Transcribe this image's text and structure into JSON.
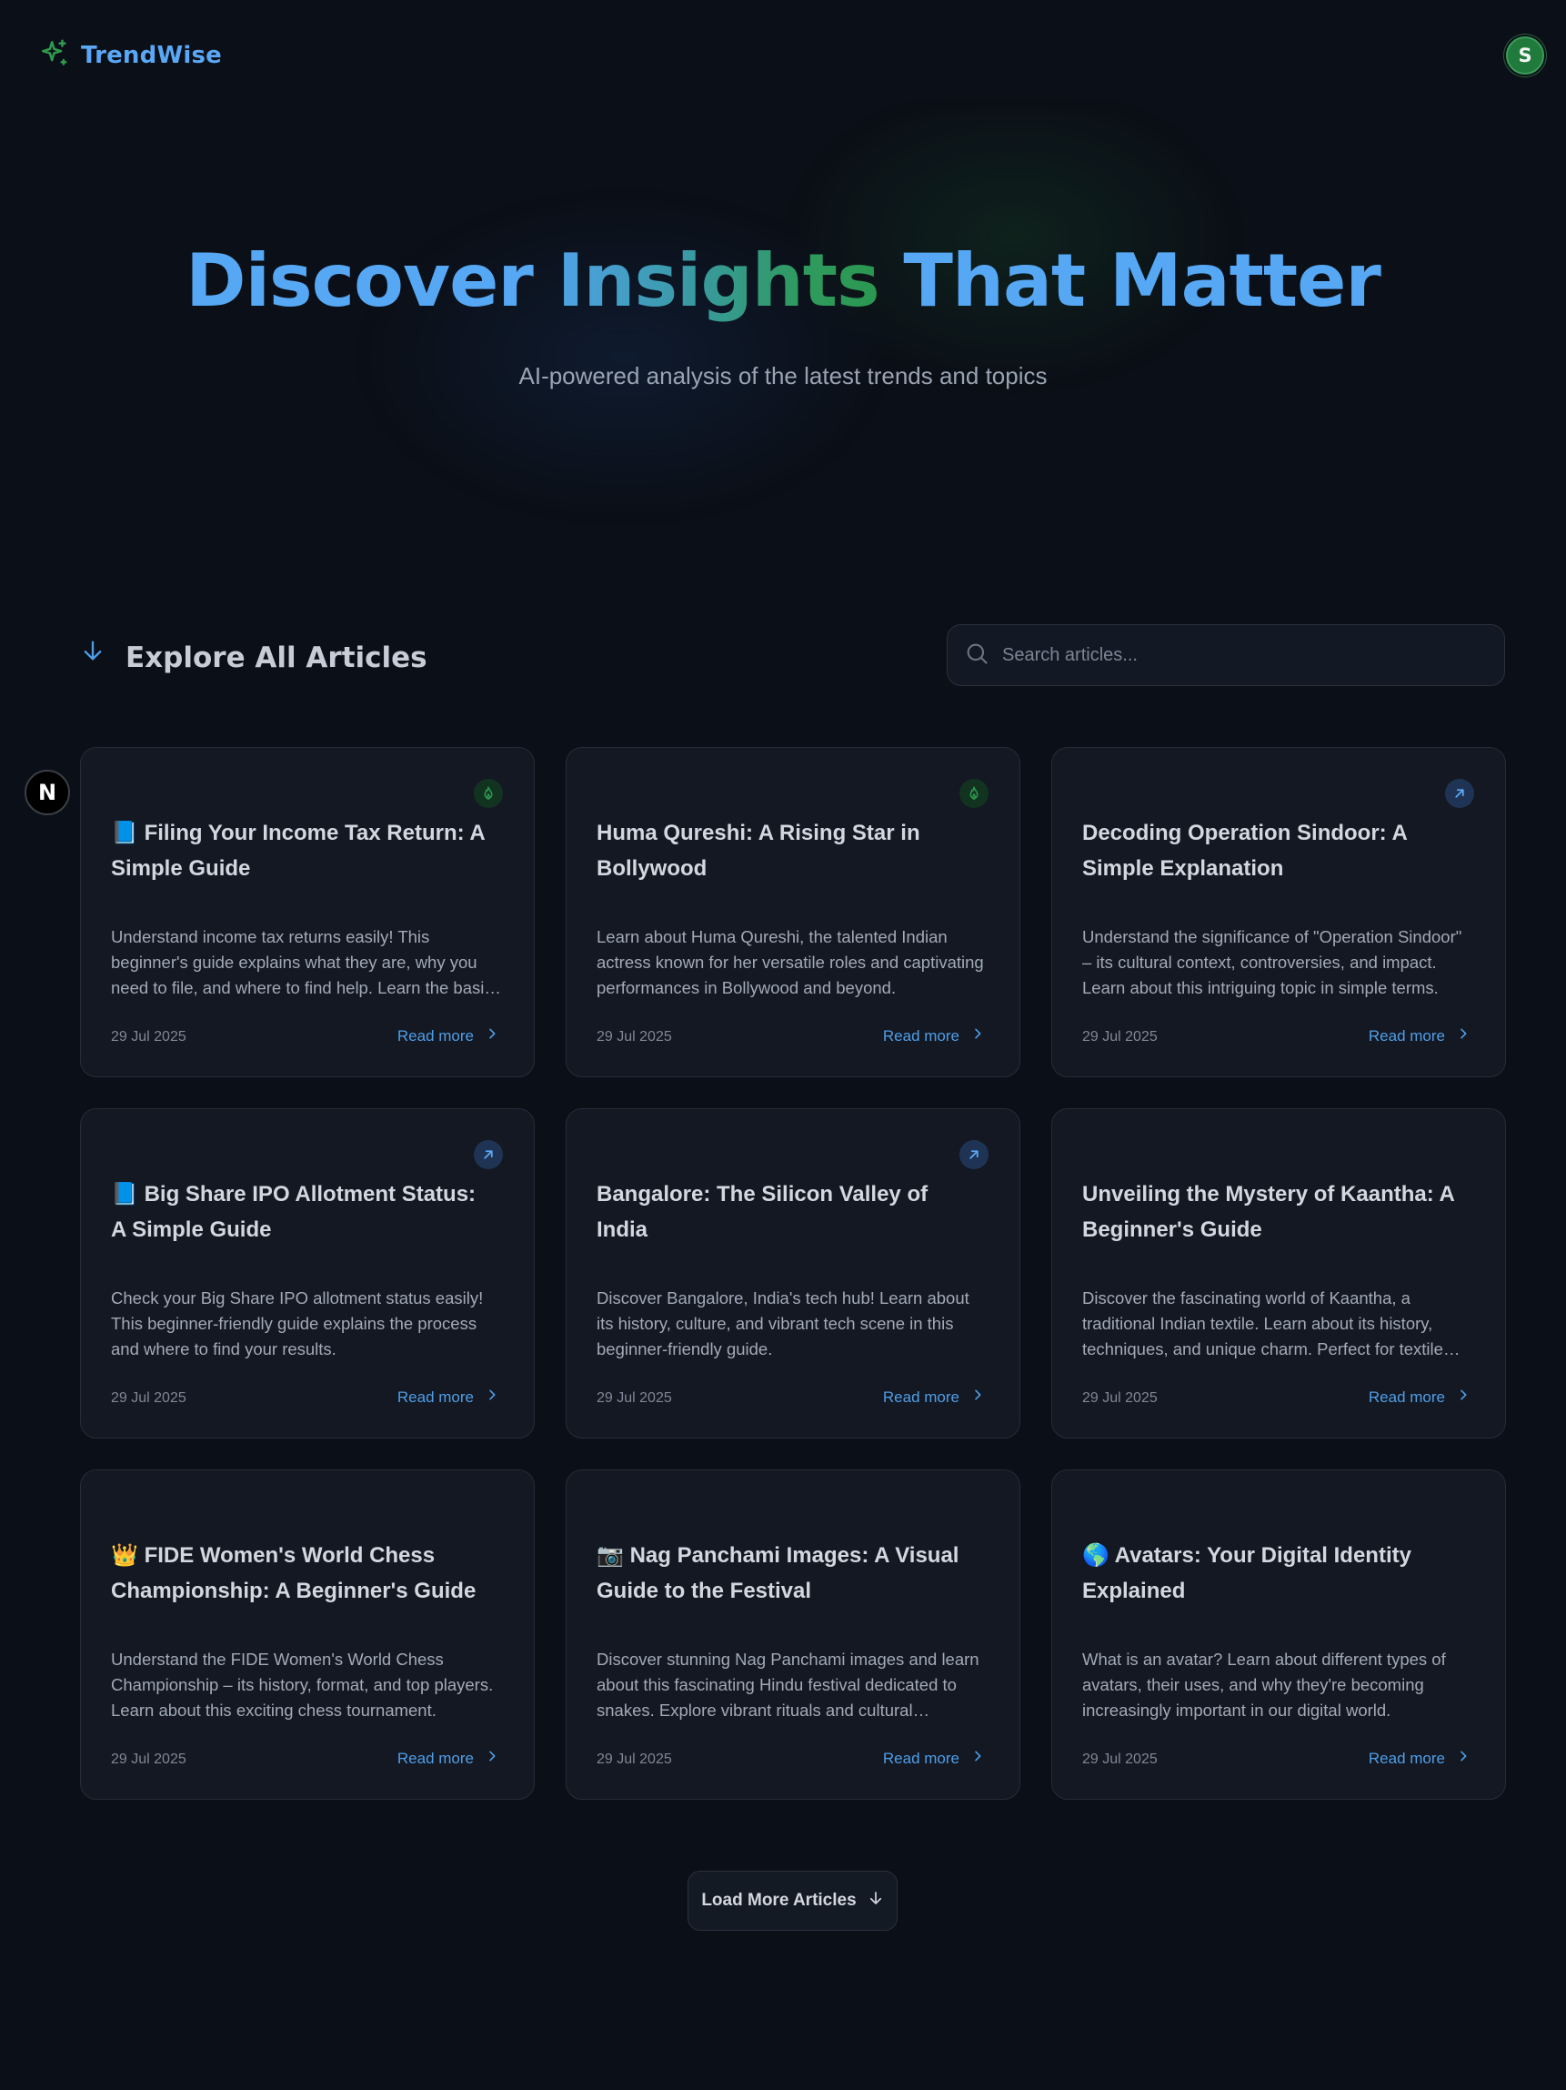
{
  "brand": {
    "name": "TrendWise",
    "icon": "sparkles-icon",
    "color": "#5aa7f5",
    "icon_color": "#2e9a4e"
  },
  "user": {
    "initial": "S",
    "color": "#1f7a3b"
  },
  "hero": {
    "title_part1": "Discover ",
    "title_part2": "Insights",
    "title_part3": " That Matter",
    "subtitle": "AI-powered analysis of the latest trends and topics"
  },
  "section": {
    "title": "Explore All Articles",
    "icon": "arrow-down-icon"
  },
  "search": {
    "placeholder": "Search articles...",
    "value": ""
  },
  "framework_badge": {
    "letter": "N"
  },
  "articles": [
    {
      "emoji": "📘",
      "title": "Filing Your Income Tax Return: A Simple Guide",
      "description": "Understand income tax returns easily! This beginner's guide explains what they are, why you need to file, and where to find help. Learn the basics today.",
      "date": "29 Jul 2025",
      "read_more": "Read more",
      "badge": "hot"
    },
    {
      "emoji": "",
      "title": "Huma Qureshi: A Rising Star in Bollywood",
      "description": "Learn about Huma Qureshi, the talented Indian actress known for her versatile roles and captivating performances in Bollywood and beyond.",
      "date": "29 Jul 2025",
      "read_more": "Read more",
      "badge": "hot"
    },
    {
      "emoji": "",
      "title": "Decoding Operation Sindoor: A Simple Explanation",
      "description": "Understand the significance of \"Operation Sindoor\" – its cultural context, controversies, and impact. Learn about this intriguing topic in simple terms.",
      "date": "29 Jul 2025",
      "read_more": "Read more",
      "badge": "trending"
    },
    {
      "emoji": "📘",
      "title": "Big Share IPO Allotment Status: A Simple Guide",
      "description": "Check your Big Share IPO allotment status easily! This beginner-friendly guide explains the process and where to find your results.",
      "date": "29 Jul 2025",
      "read_more": "Read more",
      "badge": "trending"
    },
    {
      "emoji": "",
      "title": "Bangalore: The Silicon Valley of India",
      "description": "Discover Bangalore, India's tech hub! Learn about its history, culture, and vibrant tech scene in this beginner-friendly guide.",
      "date": "29 Jul 2025",
      "read_more": "Read more",
      "badge": "trending"
    },
    {
      "emoji": "",
      "title": "Unveiling the Mystery of Kaantha: A Beginner's Guide",
      "description": "Discover the fascinating world of Kaantha, a traditional Indian textile. Learn about its history, techniques, and unique charm. Perfect for textile lovers.",
      "date": "29 Jul 2025",
      "read_more": "Read more",
      "badge": ""
    },
    {
      "emoji": "👑",
      "title": "FIDE Women's World Chess Championship: A Beginner's Guide",
      "description": "Understand the FIDE Women's World Chess Championship – its history, format, and top players. Learn about this exciting chess tournament.",
      "date": "29 Jul 2025",
      "read_more": "Read more",
      "badge": ""
    },
    {
      "emoji": "📷",
      "title": "Nag Panchami Images: A Visual Guide to the Festival",
      "description": "Discover stunning Nag Panchami images and learn about this fascinating Hindu festival dedicated to snakes. Explore vibrant rituals and cultural traditions.",
      "date": "29 Jul 2025",
      "read_more": "Read more",
      "badge": ""
    },
    {
      "emoji": "🌎",
      "title": "Avatars: Your Digital Identity Explained",
      "description": "What is an avatar? Learn about different types of avatars, their uses, and why they're becoming increasingly important in our digital world.",
      "date": "29 Jul 2025",
      "read_more": "Read more",
      "badge": ""
    }
  ],
  "load_more": {
    "label": "Load More Articles"
  },
  "colors": {
    "background": "#0b0f17",
    "card": "#131822",
    "accent": "#4f9ee8",
    "hot": "#2e9a4e"
  }
}
